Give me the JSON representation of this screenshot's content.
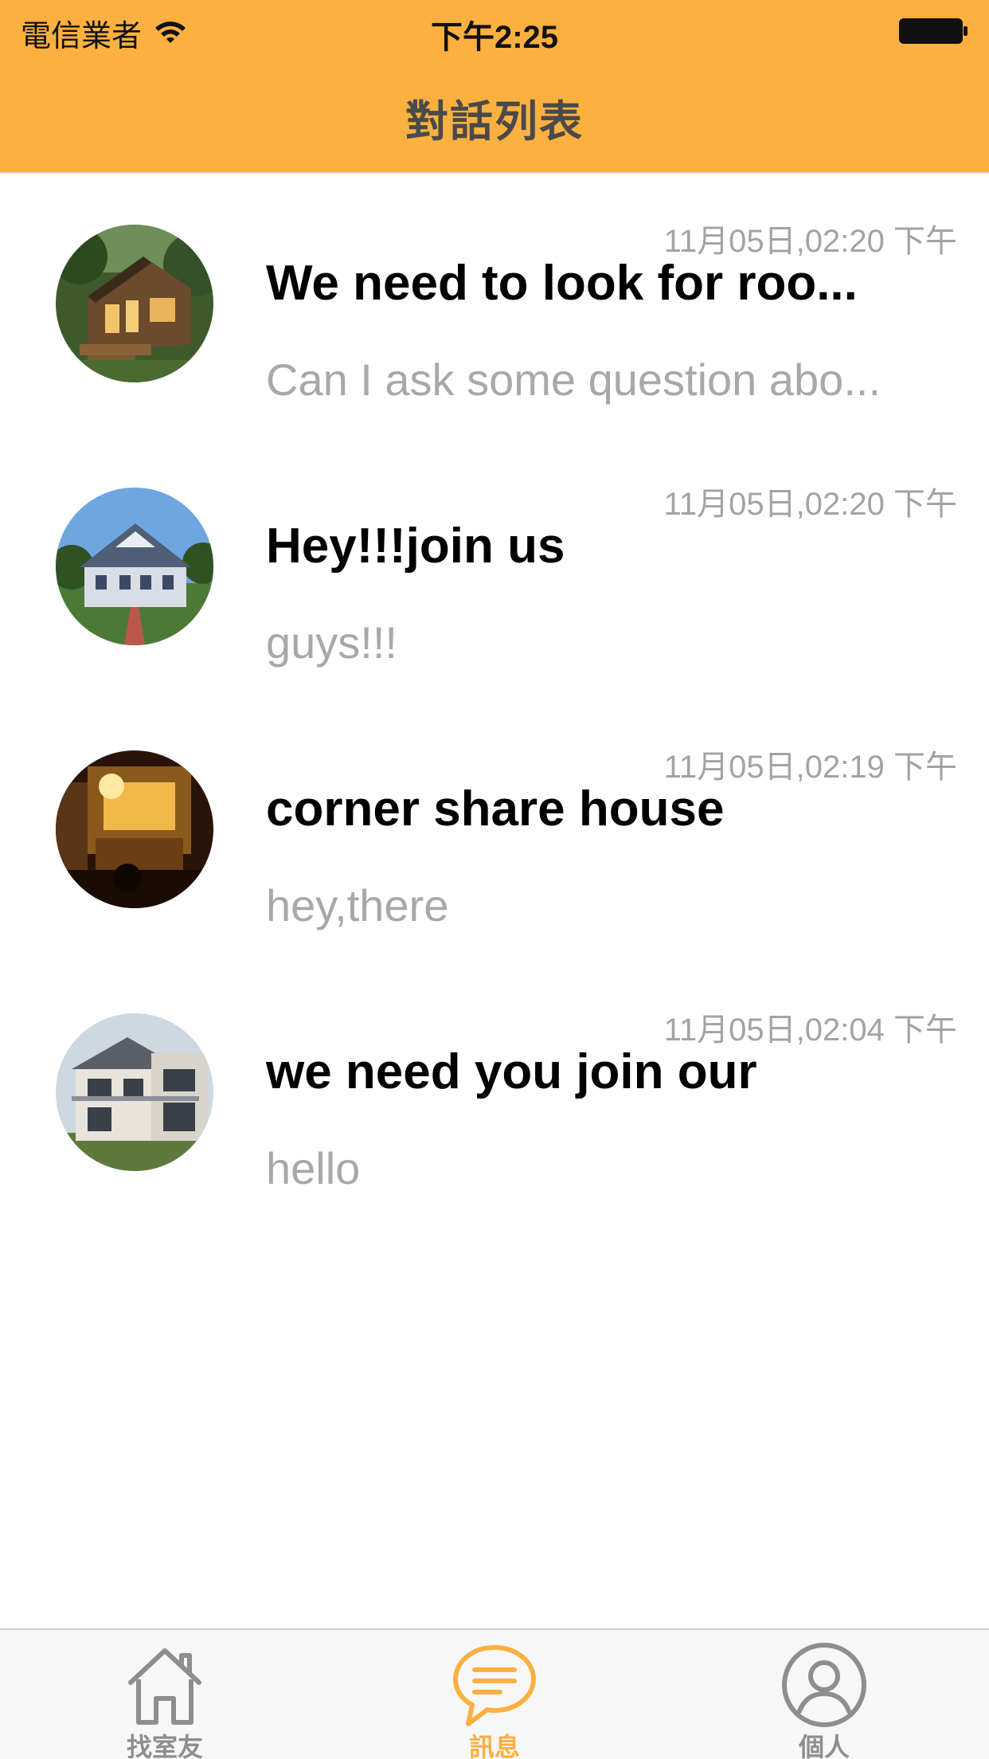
{
  "status_bar": {
    "carrier": "電信業者",
    "time": "下午2:25"
  },
  "nav": {
    "title": "對話列表"
  },
  "conversations": [
    {
      "title": "We need to look for roo...",
      "preview": "Can I ask some question abo...",
      "time": "11月05日,02:20 下午",
      "avatar": "tiny-cabin-house-photo"
    },
    {
      "title": "Hey!!!join us",
      "preview": "guys!!!",
      "time": "11月05日,02:20 下午",
      "avatar": "blue-house-photo"
    },
    {
      "title": "corner share house",
      "preview": "hey,there",
      "time": "11月05日,02:19 下午",
      "avatar": "cozy-room-photo"
    },
    {
      "title": "we need you join our",
      "preview": "hello",
      "time": "11月05日,02:04 下午",
      "avatar": "modern-house-photo"
    }
  ],
  "tabbar": {
    "tabs": [
      {
        "label": "找室友",
        "icon": "house-icon",
        "active": false
      },
      {
        "label": "訊息",
        "icon": "chat-bubble-icon",
        "active": true
      },
      {
        "label": "個人",
        "icon": "person-icon",
        "active": false
      }
    ]
  },
  "colors": {
    "accent": "#fbb040",
    "title_text": "#4a4a4a",
    "secondary_text": "#a8a8a8",
    "inactive_tab": "#8e8e8e"
  }
}
